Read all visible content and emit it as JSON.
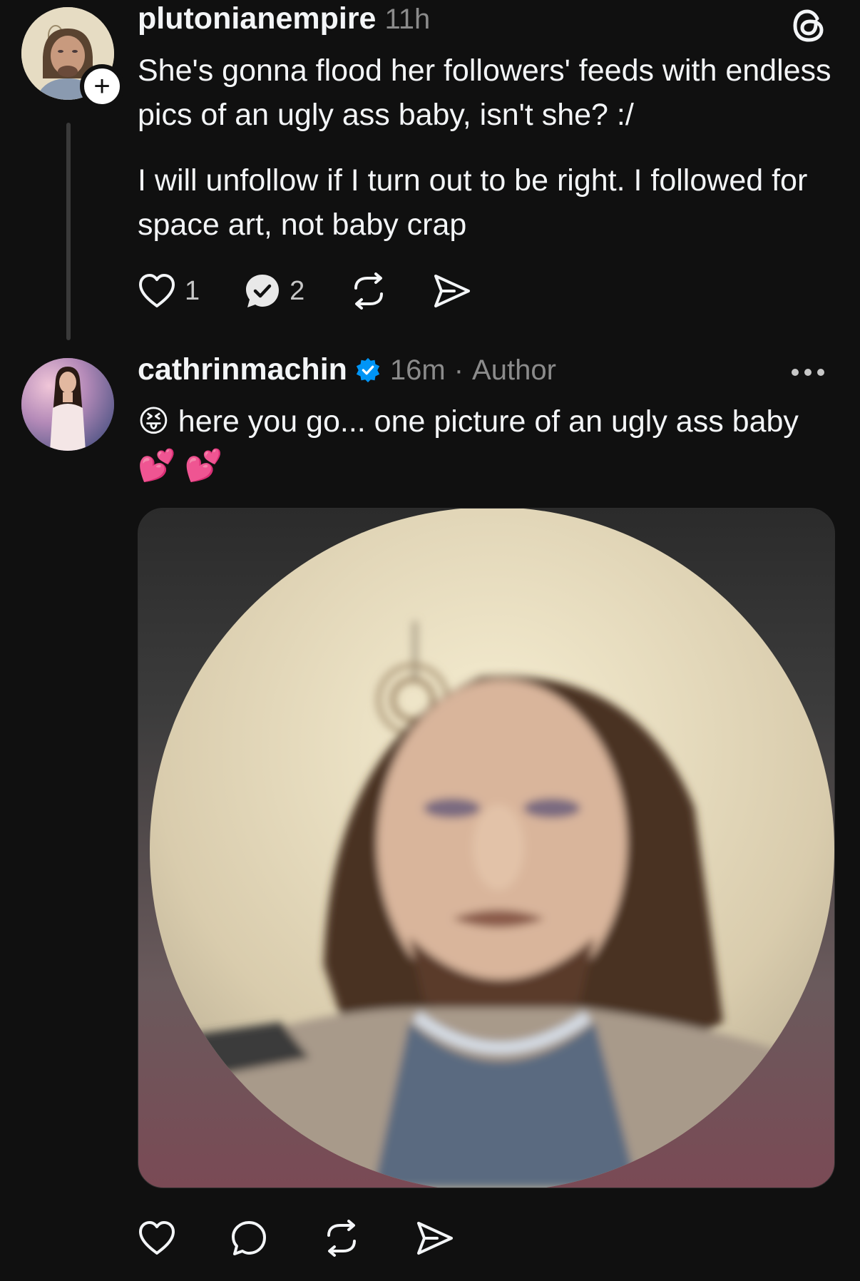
{
  "post1": {
    "username": "plutonianempire",
    "time": "11h",
    "paragraphs": [
      "She's gonna flood her followers' feeds with endless pics of an ugly ass baby, isn't she? :/",
      "I will unfollow if I turn out to be right. I followed for space art, not baby crap"
    ],
    "likes": "1",
    "replies": "2",
    "follow_symbol": "+"
  },
  "post2": {
    "username": "cathrinmachin",
    "time": "16m",
    "separator": "·",
    "author_label": "Author",
    "text": "😝 here you go... one picture of an ugly ass baby 💕 💕"
  },
  "icons": {
    "like": "heart-icon",
    "reply": "reply-icon",
    "repost": "repost-icon",
    "share": "share-icon",
    "verified": "verified-badge-icon",
    "threads": "threads-logo-icon",
    "more": "more-options-icon"
  },
  "colors": {
    "background": "#101010",
    "text": "#f3f5f7",
    "secondary_text": "#8b8b8b",
    "verified_blue": "#0095f6"
  }
}
